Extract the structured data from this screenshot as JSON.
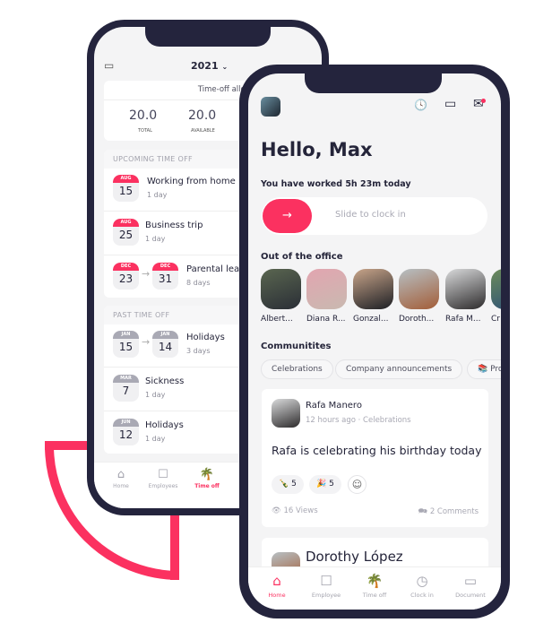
{
  "colors": {
    "accent": "#fb3160",
    "frame": "#24243d",
    "text": "#25253a"
  },
  "timeoff_screen": {
    "year": "2021",
    "year_icon": "chevron-down-icon",
    "allowance": {
      "title": "Time-off allowance",
      "total_value": "20.0",
      "total_label": "TOTAL",
      "available_value": "20.0",
      "available_label": "AVAILABLE"
    },
    "upcoming": {
      "header": "UPCOMING TIME OFF",
      "items": [
        {
          "start_month": "AUG",
          "start_day": "15",
          "title": "Working from home",
          "duration": "1 day"
        },
        {
          "start_month": "AUG",
          "start_day": "25",
          "title": "Business trip",
          "duration": "1 day"
        },
        {
          "start_month": "DEC",
          "start_day": "23",
          "end_month": "DEC",
          "end_day": "31",
          "title": "Parental leave",
          "duration": "8 days"
        }
      ]
    },
    "past": {
      "header": "PAST TIME OFF",
      "items": [
        {
          "start_month": "JAN",
          "start_day": "15",
          "end_month": "JAN",
          "end_day": "14",
          "title": "Holidays",
          "duration": "3 days"
        },
        {
          "start_month": "MAR",
          "start_day": "7",
          "title": "Sickness",
          "duration": "1 day"
        },
        {
          "start_month": "JUN",
          "start_day": "12",
          "title": "Holidays",
          "duration": "1 day"
        }
      ]
    },
    "tabs": [
      {
        "label": "Home"
      },
      {
        "label": "Employees"
      },
      {
        "label": "Time off",
        "active": true
      }
    ]
  },
  "home_screen": {
    "greeting": "Hello, Max",
    "worked": "You have worked 5h 23m today",
    "slider_label": "Slide to clock in",
    "out_title": "Out of the office",
    "people": [
      {
        "name": "Albert..."
      },
      {
        "name": "Diana R..."
      },
      {
        "name": "Gonzal..."
      },
      {
        "name": "Doroth..."
      },
      {
        "name": "Rafa M..."
      },
      {
        "name": "Cr"
      }
    ],
    "communities_title": "Communitites",
    "chips": [
      "Celebrations",
      "Company announcements",
      "📚 Pro"
    ],
    "post": {
      "author": "Rafa Manero",
      "time": "12 hours ago",
      "dot": "·",
      "community": "Celebrations",
      "body": "Rafa is celebrating his birthday today",
      "reactions": [
        {
          "emoji": "🍾",
          "count": "5"
        },
        {
          "emoji": "🎉",
          "count": "5"
        }
      ],
      "views": "16 Views",
      "comments": "2 Comments"
    },
    "next_post_author": "Dorothy López",
    "tabs": [
      {
        "label": "Home",
        "active": true
      },
      {
        "label": "Employee"
      },
      {
        "label": "Time off"
      },
      {
        "label": "Clock in"
      },
      {
        "label": "Document"
      }
    ]
  }
}
